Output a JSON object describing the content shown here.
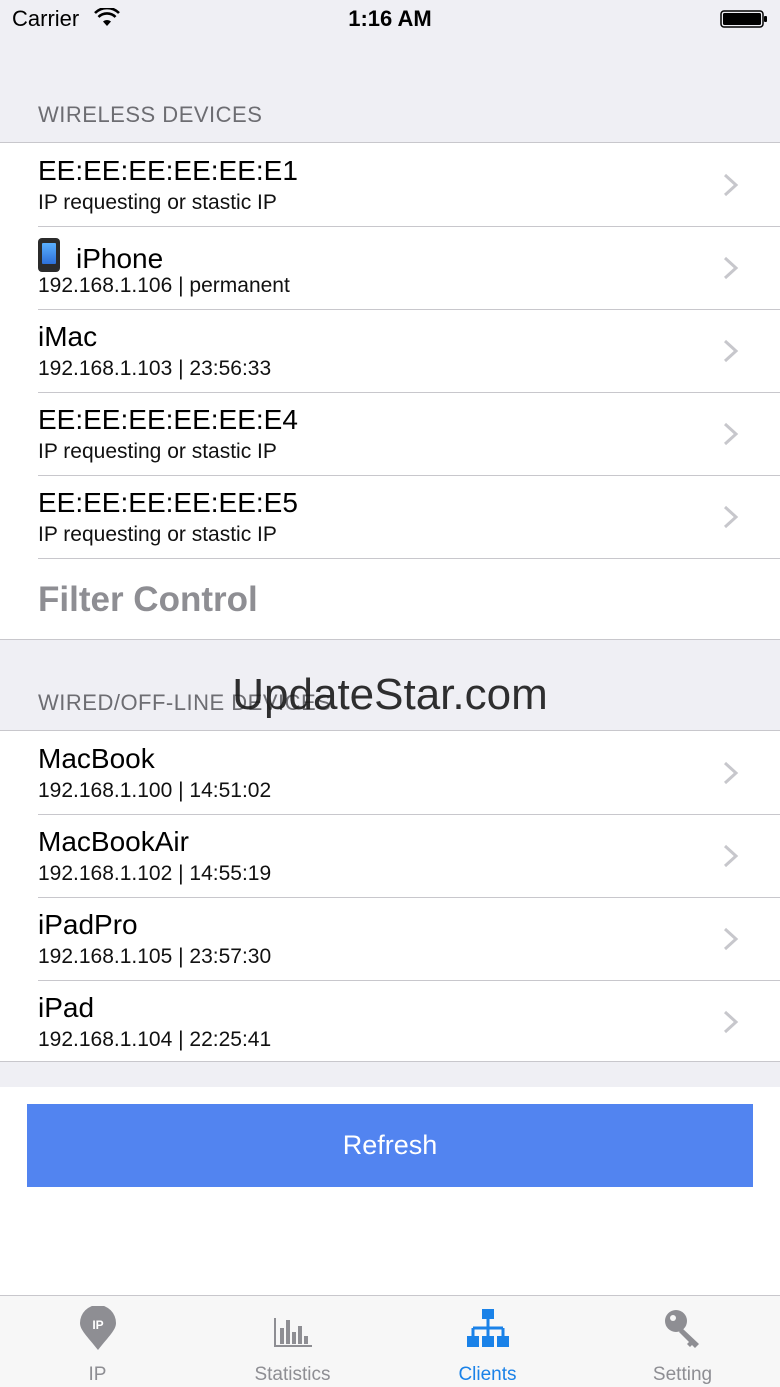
{
  "status_bar": {
    "carrier": "Carrier",
    "time": "1:16 AM"
  },
  "wireless": {
    "header": "WIRELESS DEVICES",
    "items": [
      {
        "title": "EE:EE:EE:EE:EE:E1",
        "subtitle": "IP requesting or stastic IP"
      },
      {
        "title": "iPhone",
        "subtitle": "192.168.1.106 | permanent",
        "icon": "phone-icon"
      },
      {
        "title": "iMac",
        "subtitle": "192.168.1.103 | 23:56:33"
      },
      {
        "title": "EE:EE:EE:EE:EE:E4",
        "subtitle": "IP requesting or stastic IP"
      },
      {
        "title": "EE:EE:EE:EE:EE:E5",
        "subtitle": "IP requesting or stastic IP"
      }
    ],
    "filter_label": "Filter Control"
  },
  "wired": {
    "header": "WIRED/OFF-LINE DEVICES",
    "items": [
      {
        "title": "MacBook",
        "subtitle": "192.168.1.100 | 14:51:02"
      },
      {
        "title": "MacBookAir",
        "subtitle": "192.168.1.102 | 14:55:19"
      },
      {
        "title": "iPadPro",
        "subtitle": "192.168.1.105 | 23:57:30"
      },
      {
        "title": "iPad",
        "subtitle": "192.168.1.104 | 22:25:41"
      }
    ]
  },
  "watermark": "UpdateStar.com",
  "refresh_label": "Refresh",
  "tabs": [
    {
      "label": "IP",
      "icon": "ip-pin-icon",
      "pin_text": "IP"
    },
    {
      "label": "Statistics",
      "icon": "bar-chart-icon"
    },
    {
      "label": "Clients",
      "icon": "network-icon",
      "active": true
    },
    {
      "label": "Setting",
      "icon": "key-icon"
    }
  ],
  "colors": {
    "accent": "#1a82e8",
    "button": "#5284f0",
    "inactive": "#8e8e93"
  }
}
